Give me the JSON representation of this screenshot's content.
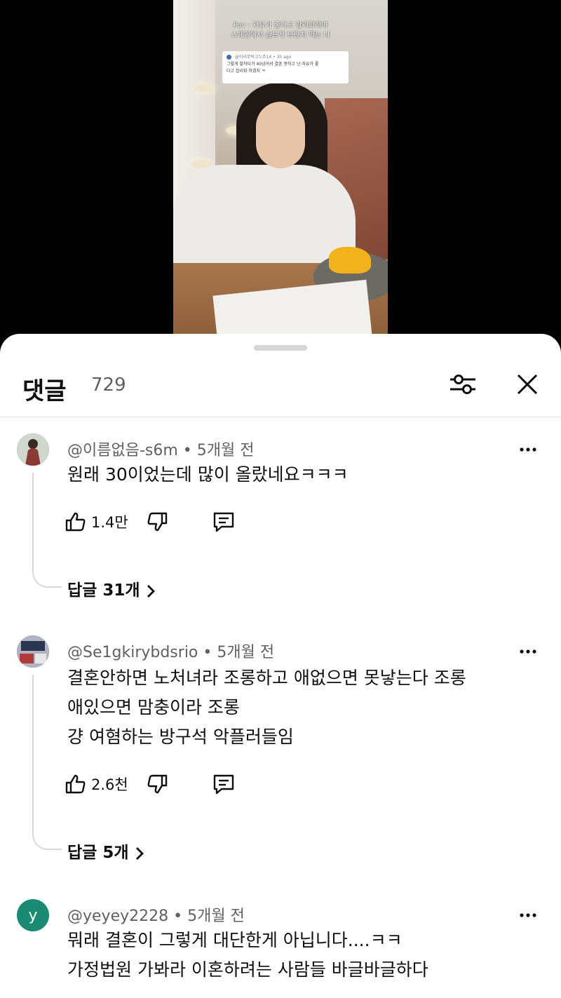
{
  "video": {
    "caption_line1": "Pov : 자유가 좋다고 합리화하며",
    "caption_line2": "스페인에서 슬프게 브런치 먹는 나",
    "reply_card": {
      "author": "@이리쭈릭고누주14",
      "time": "3h ago",
      "text_line1": "그렇게 말하다가 40넘어서 결혼 못하고 난 자유가 좋",
      "text_line2": "다고 합리화 하겠지 ㅋ"
    }
  },
  "panel": {
    "title": "댓글",
    "count": "729",
    "filter_icon": "sliders-icon",
    "close_icon": "close-icon"
  },
  "comments": [
    {
      "author": "@이름없음-s6m",
      "time": "5개월 전",
      "lines": [
        "원래 30이었는데 많이 올랐네요ㅋㅋㅋ"
      ],
      "likes": "1.4만",
      "replies": "답글 31개",
      "avatar_color": "#3a4a3a"
    },
    {
      "author": "@Se1gkirybdsrio",
      "time": "5개월 전",
      "lines": [
        "결혼안하면 노처녀라 조롱하고 애없으면 못낳는다 조롱",
        "애있으면 맘충이라 조롱",
        "걍 여혐하는 방구석 악플러들임"
      ],
      "likes": "2.6천",
      "replies": "답글 5개",
      "avatar_color": "#5a6378"
    },
    {
      "author": "@yeyey2228",
      "time": "5개월 전",
      "lines": [
        "뭐래 결혼이 그렇게 대단한게 아닙니다....ㅋㅋ",
        "가정법원 가봐라 이혼하려는 사람들 바글바글하다"
      ],
      "avatar_letter": "y",
      "avatar_color": "#1a8a72"
    }
  ],
  "separator": "•"
}
